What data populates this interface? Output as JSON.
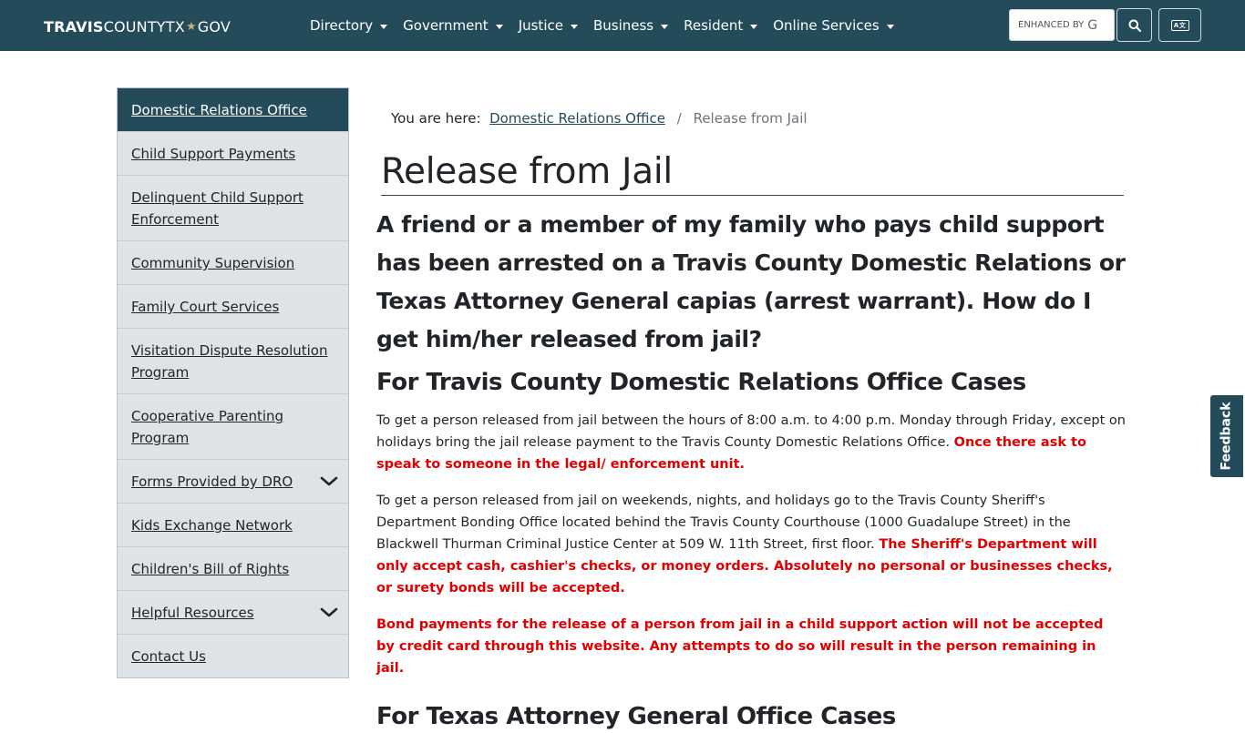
{
  "header": {
    "logo_bold": "TRAVIS",
    "logo_light": "COUNTY",
    "logo_tx": "TX",
    "logo_gov": "GOV",
    "nav": [
      {
        "label": "Directory"
      },
      {
        "label": "Government"
      },
      {
        "label": "Justice"
      },
      {
        "label": "Business"
      },
      {
        "label": "Resident"
      },
      {
        "label": "Online Services"
      }
    ],
    "search_placeholder": "ENHANCED BY",
    "search_brand": "G"
  },
  "sidebar": {
    "items": [
      {
        "label": "Domestic Relations Office"
      },
      {
        "label": "Child Support Payments"
      },
      {
        "label": "Delinquent Child Support Enforcement"
      },
      {
        "label": "Community Supervision"
      },
      {
        "label": "Family Court Services"
      },
      {
        "label": "Visitation Dispute Resolution Program"
      },
      {
        "label": "Cooperative Parenting Program"
      },
      {
        "label": "Forms Provided by DRO"
      },
      {
        "label": "Kids Exchange Network"
      },
      {
        "label": "Children's Bill of Rights"
      },
      {
        "label": "Helpful Resources"
      },
      {
        "label": "Contact Us"
      }
    ]
  },
  "breadcrumb": {
    "prefix": "You are here:",
    "link": "Domestic Relations Office",
    "separator": "/",
    "current": "Release from Jail"
  },
  "page": {
    "title": "Release from Jail",
    "question": "A friend or a member of my family who pays child support has been arrested on a Travis County Domestic Relations or Texas Attorney General capias (arrest warrant). How do I get him/her released from jail?",
    "section1_heading": "For Travis County Domestic Relations Office Cases",
    "p1_text": "To get a person released from jail between the hours of 8:00 a.m. to 4:00 p.m. Monday through Friday, except on holidays bring the jail release payment to the Travis County Domestic Relations Office.",
    "p1_red": "Once there ask to speak to someone in the legal/ enforcement unit.",
    "p2_text": "To get a person released from jail on weekends, nights, and holidays go to the Travis County Sheriff's Department Bonding Office located behind the Travis County Courthouse (1000 Guadalupe Street) in the Blackwell Thurman Criminal Justice Center at 509 W. 11th Street, first floor.",
    "p2_red": "The Sheriff's Department will only accept cash, cashier's checks, or money orders. Absolutely no personal or businesses checks, or surety bonds will be accepted.",
    "p3_red": "Bond payments for the release of a person from jail in a child support action will not be accepted by credit card through this website. Any attempts to do so will result in the person remaining in jail.",
    "section2_heading": "For Texas Attorney General Office Cases"
  },
  "feedback_label": "Feedback",
  "colors": {
    "header_bg": "#244b5a",
    "sidebar_bg": "#dde3e6",
    "alert_red": "#e00000"
  }
}
